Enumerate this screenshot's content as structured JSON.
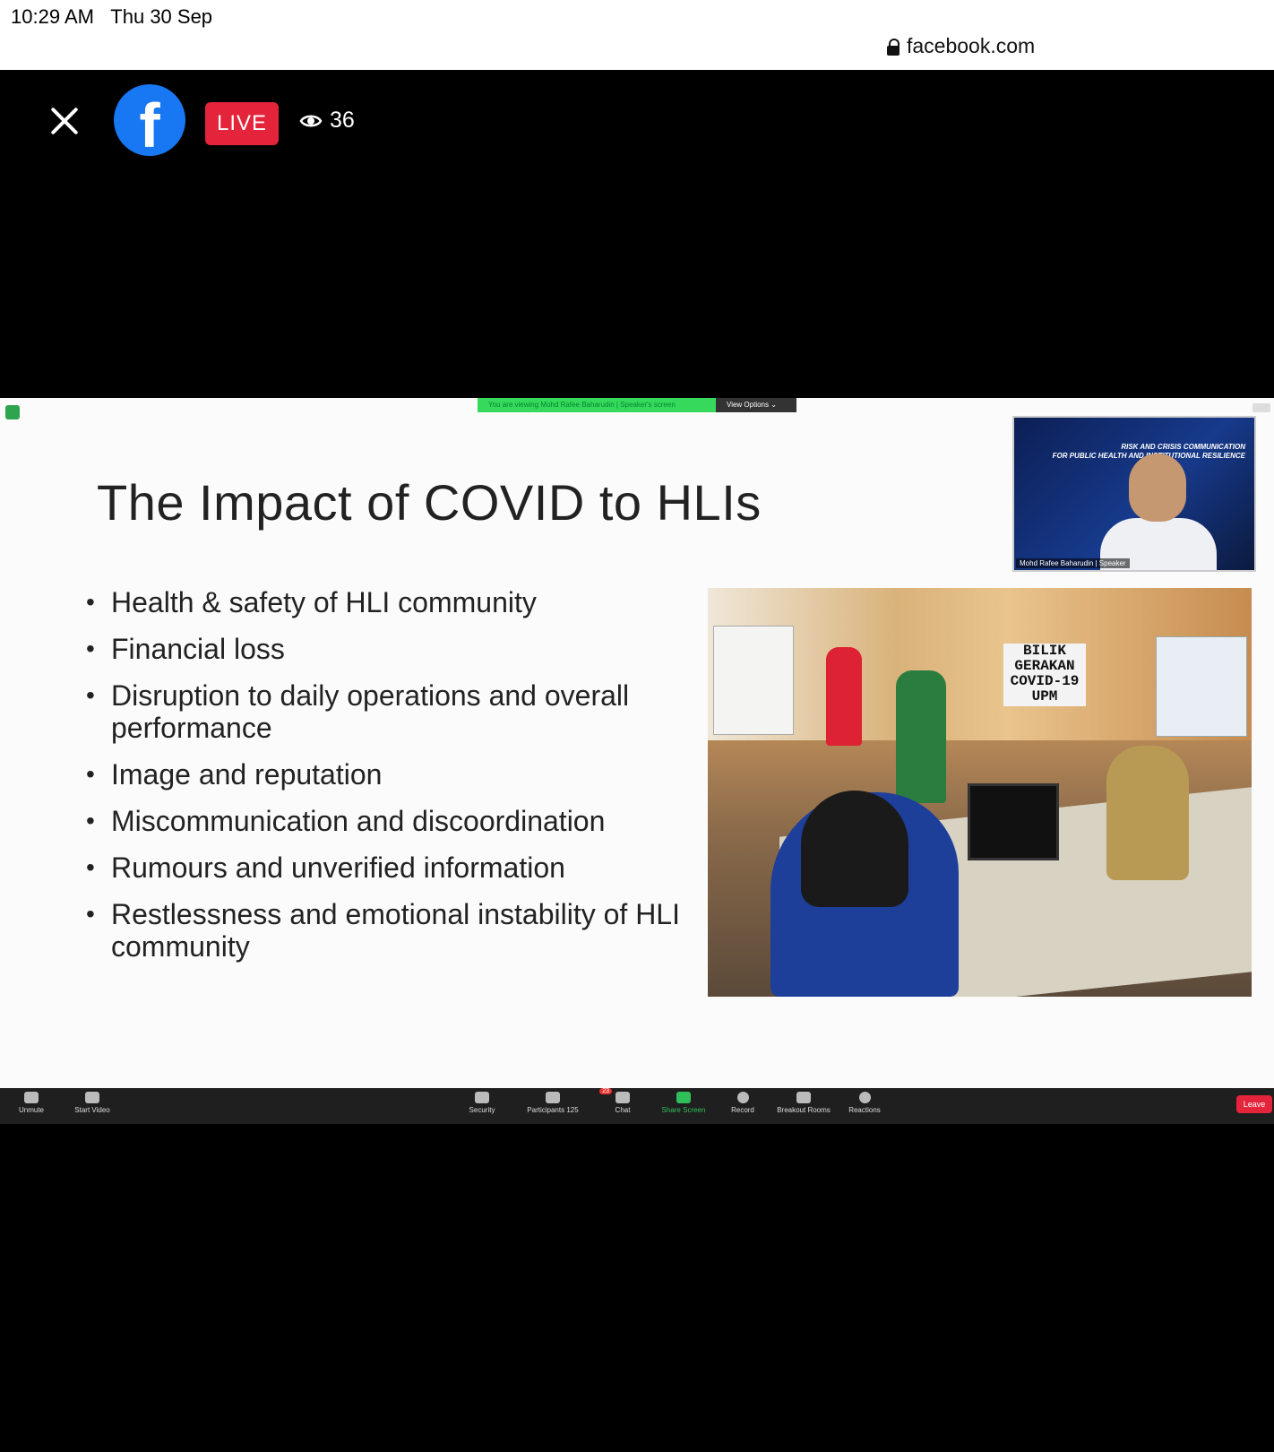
{
  "status": {
    "time": "10:29 AM",
    "date": "Thu 30 Sep",
    "url": "facebook.com"
  },
  "fb": {
    "live_label": "LIVE",
    "viewer_count": "36"
  },
  "zoom": {
    "banner_viewing": "You are viewing Mohd Rafee Baharudin | Speaker's screen",
    "banner_options": "View Options ⌄",
    "speaker_name": "Mohd Rafee Baharudin | Speaker",
    "speaker_event_line1": "RISK AND CRISIS COMMUNICATION",
    "speaker_event_line2": "FOR PUBLIC HEALTH AND INSTITUTIONAL RESILIENCE",
    "toolbar": {
      "unmute": "Unmute",
      "start_video": "Start Video",
      "security": "Security",
      "participants": "Participants",
      "participants_count": "125",
      "chat": "Chat",
      "chat_badge": "23",
      "share_screen": "Share Screen",
      "record": "Record",
      "breakout_rooms": "Breakout Rooms",
      "reactions": "Reactions",
      "leave": "Leave"
    }
  },
  "slide": {
    "title": "The Impact of COVID to HLIs",
    "bullets": [
      "Health & safety of HLI community",
      "Financial loss",
      "Disruption to daily operations and overall performance",
      "Image and reputation",
      "Miscommunication and discoordination",
      "Rumours and unverified information",
      "Restlessness and emotional instability of HLI community"
    ],
    "photo_sign": [
      "BILIK",
      "GERAKAN",
      "COVID-19",
      "UPM"
    ]
  },
  "colors": {
    "fb_blue": "#1877f2",
    "live_red": "#e4243b",
    "zoom_share_green": "#2fbf5a"
  }
}
